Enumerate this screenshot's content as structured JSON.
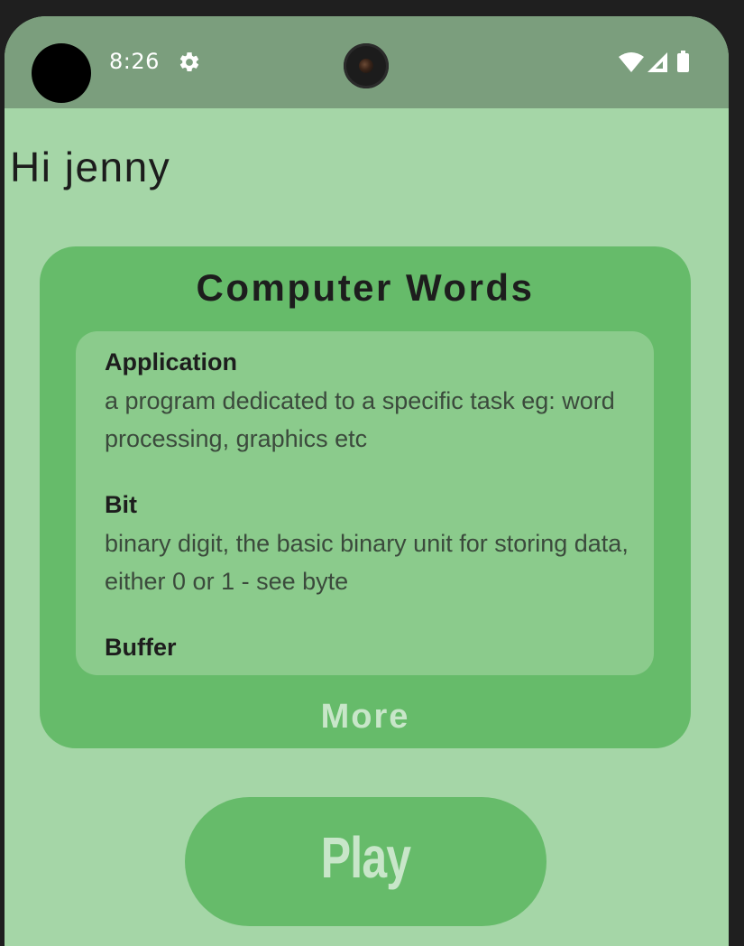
{
  "status_bar": {
    "time": "8:26",
    "icons": [
      "settings-gear-icon",
      "wifi-icon",
      "cellular-signal-icon",
      "battery-icon"
    ],
    "background_color": "#7b9e7d"
  },
  "greeting": "Hi jenny",
  "words_card": {
    "title": "Computer Words",
    "words": [
      {
        "term": "Application",
        "definition": "a program dedicated to a specific task eg: word processing, graphics etc"
      },
      {
        "term": "Bit",
        "definition": "binary digit, the basic binary unit for storing data, either 0 or 1 - see byte"
      },
      {
        "term": "Buffer",
        "definition": ""
      }
    ],
    "more_label": "More"
  },
  "play_button": {
    "label": "Play"
  },
  "colors": {
    "background": "#a5d6a7",
    "card": "#66bb6a",
    "list": "#8bcb8c",
    "button_text": "#c8e6c9"
  }
}
